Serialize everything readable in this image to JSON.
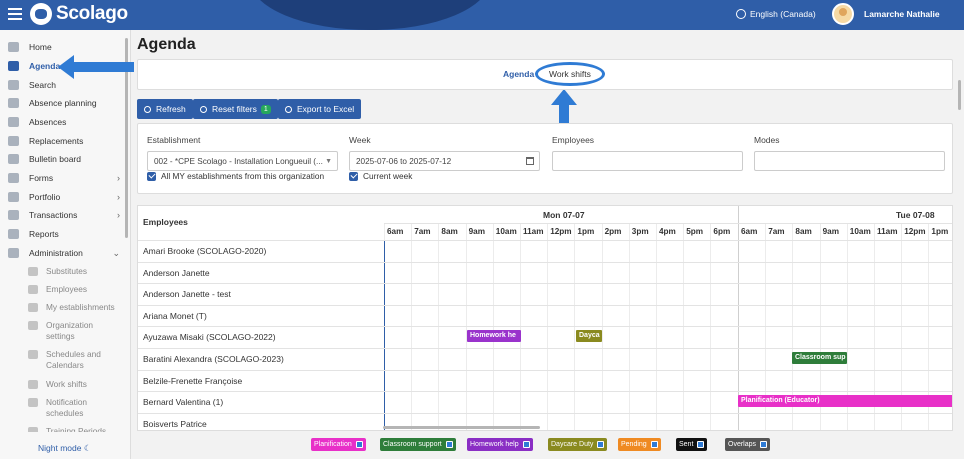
{
  "app": {
    "name": "Scolago",
    "language": "English (Canada)",
    "user": "Lamarche Nathalie"
  },
  "sidebar": {
    "items": [
      {
        "label": "Home",
        "icon": "home-icon"
      },
      {
        "label": "Agenda",
        "icon": "calendar-icon",
        "active": true
      },
      {
        "label": "Search",
        "icon": "search-icon"
      },
      {
        "label": "Absence planning",
        "icon": "calendar-icon"
      },
      {
        "label": "Absences",
        "icon": "user-icon"
      },
      {
        "label": "Replacements",
        "icon": "swap-icon"
      },
      {
        "label": "Bulletin board",
        "icon": "board-icon"
      },
      {
        "label": "Forms",
        "icon": "folder-icon",
        "chevron": true
      },
      {
        "label": "Portfolio",
        "icon": "trophy-icon",
        "chevron": true
      },
      {
        "label": "Transactions",
        "icon": "credit-card-icon",
        "chevron": true
      },
      {
        "label": "Reports",
        "icon": "report-icon"
      },
      {
        "label": "Administration",
        "icon": "gear-icon",
        "chevron_down": true
      }
    ],
    "sub_items": [
      {
        "label": "Substitutes"
      },
      {
        "label": "Employees"
      },
      {
        "label": "My establishments"
      },
      {
        "label": "Organization settings"
      },
      {
        "label": "Schedules and Calendars"
      },
      {
        "label": "Work shifts"
      },
      {
        "label": "Notification schedules"
      },
      {
        "label": "Training Periods"
      }
    ],
    "night_mode": "Night mode"
  },
  "page": {
    "title": "Agenda"
  },
  "tabs": [
    {
      "label": "Agenda",
      "active": true
    },
    {
      "label": "Work shifts"
    }
  ],
  "toolbar": {
    "refresh": "Refresh",
    "reset_filters": "Reset filters",
    "reset_count": "1",
    "export": "Export to Excel"
  },
  "filters": {
    "establishment_label": "Establishment",
    "establishment_value": "002 - *CPE Scolago - Installation Longueuil (...",
    "all_establishments": "All MY establishments from this organization",
    "week_label": "Week",
    "week_value": "2025-07-06 to 2025-07-12",
    "current_week": "Current week",
    "employees_label": "Employees",
    "modes_label": "Modes"
  },
  "grid": {
    "employees_header": "Employees",
    "days": [
      {
        "label": "Mon 07-07",
        "hours": [
          "6am",
          "7am",
          "8am",
          "9am",
          "10am",
          "11am",
          "12pm",
          "1pm",
          "2pm",
          "3pm",
          "4pm",
          "5pm",
          "6pm"
        ]
      },
      {
        "label": "Tue 07-08",
        "hours": [
          "6am",
          "7am",
          "8am",
          "9am",
          "10am",
          "11am",
          "12pm",
          "1pm"
        ]
      }
    ],
    "employees": [
      "Amari Brooke (SCOLAGO-2020)",
      "Anderson Janette",
      "Anderson Janette - test",
      "Ariana Monet (T)",
      "Ayuzawa Misaki (SCOLAGO-2022)",
      "Baratini Alexandra (SCOLAGO-2023)",
      "Belzile-Frenette Françoise",
      "Bernard Valentina (1)",
      "Boisverts Patrice"
    ],
    "events": [
      {
        "row": 4,
        "label": "Homework he",
        "color": "#9a33cc"
      },
      {
        "row": 4,
        "label": "Dayca",
        "color": "#8a8a1f"
      },
      {
        "row": 5,
        "label": "Classroom sup",
        "color": "#2e7d3a"
      },
      {
        "row": 7,
        "label": "Planification (Educator)",
        "color": "#e830c8"
      }
    ]
  },
  "legend": [
    {
      "label": "Planification",
      "color": "#e830c8"
    },
    {
      "label": "Classroom support",
      "color": "#2e7d3a"
    },
    {
      "label": "Homework help",
      "color": "#8a2ec4"
    },
    {
      "label": "Daycare Duty",
      "color": "#8a8a1f"
    },
    {
      "label": "Pending",
      "color": "#ef8a22"
    },
    {
      "label": "Sent",
      "color": "#111111"
    },
    {
      "label": "Overlaps",
      "color": "#555555"
    }
  ]
}
